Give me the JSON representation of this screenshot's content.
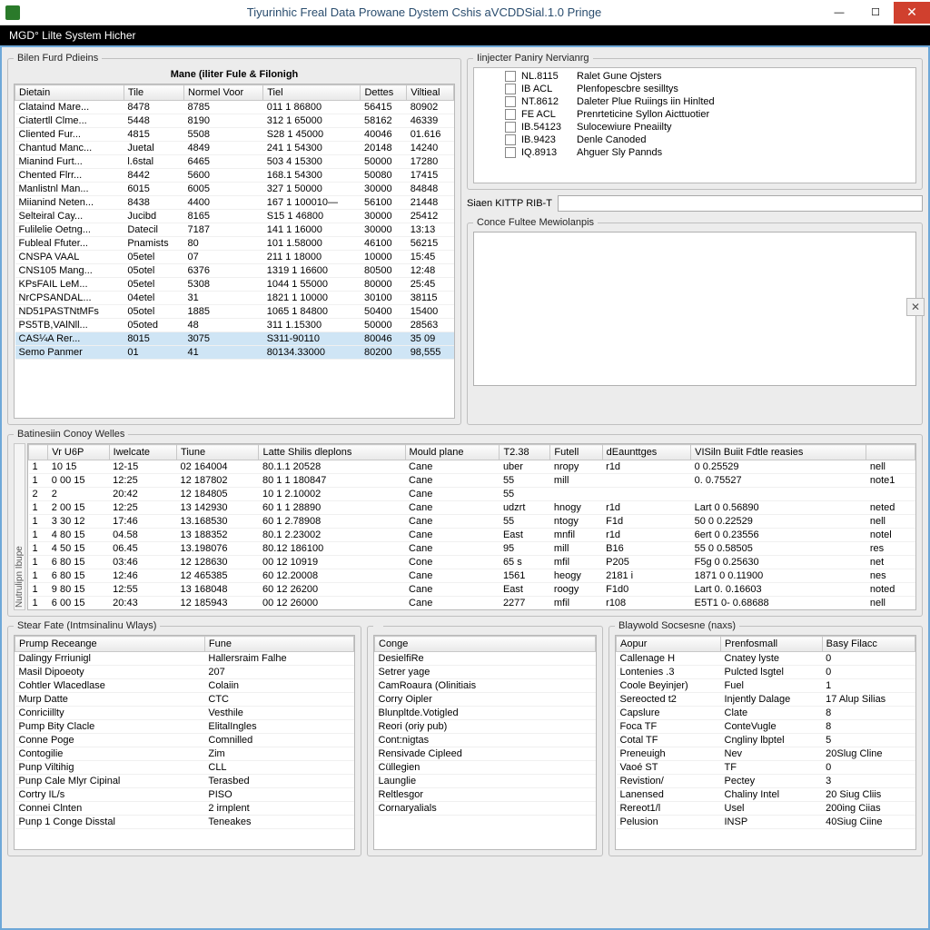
{
  "titlebar": {
    "title": "Tiyurinhic Freal Data Prowane Dystem Cshis aVCDDSial.1.0 Pringe"
  },
  "subheader": "MGD° Lilte System Hicher",
  "panel_filen": {
    "legend": "Bilen Furd Pdieins",
    "title": "Mane (iliter Fule & Filonigh",
    "columns": [
      "Dietain",
      "Tile",
      "Normel Voor",
      "Tiel",
      "Dettes",
      "Viltieal"
    ],
    "rows": [
      [
        "Clataind Mare...",
        "8478",
        "8785",
        "011 1 86800",
        "56415",
        "80902"
      ],
      [
        "Ciatertll Clme...",
        "5448",
        "8190",
        "312 1 65000",
        "58162",
        "46339"
      ],
      [
        "Cliented Fur...",
        "4815",
        "5508",
        "S28 1 45000",
        "40046",
        "01.616"
      ],
      [
        "Chantud Manc...",
        "Juetal",
        "4849",
        "241 1 54300",
        "20148",
        "14240"
      ],
      [
        "Mianind Furt...",
        "l.6stal",
        "6465",
        "503 4 15300",
        "50000",
        "17280"
      ],
      [
        "Chented Flrr...",
        "8442",
        "5600",
        "168.1 54300",
        "50080",
        "17415"
      ],
      [
        "Manlistnl Man...",
        "6015",
        "6005",
        "327 1 50000",
        "30000",
        "84848"
      ],
      [
        "Miianind Neten...",
        "8438",
        "4400",
        "167 1 100010—",
        "56100",
        "21448"
      ],
      [
        "Selteiral Cay...",
        "Jucibd",
        "8165",
        "S15  1 46800",
        "30000",
        "25412"
      ],
      [
        "Fulilelie Oetng...",
        "Datecil",
        "7187",
        "141 1 16000",
        "30000",
        "13:13"
      ],
      [
        "Fubleal Ffuter...",
        "Pnamists",
        "80",
        "101 1.58000",
        "46100",
        "56215"
      ]
    ],
    "rows2": [
      [
        "CNSPA VAAL",
        "05etel",
        "07",
        "211 1 18000",
        "10000",
        "15:45"
      ],
      [
        "CNS105 Mang...",
        "05otel",
        "6376",
        "1319 1 16600",
        "80500",
        "12:48"
      ],
      [
        "KPsFAIL LeM...",
        "05etel",
        "5308",
        "1044 1 55000",
        "80000",
        "25:45"
      ],
      [
        "NrCPSANDAL...",
        "04etel",
        "31",
        "1821 1 10000",
        "30100",
        "38115"
      ],
      [
        "ND51PASTNtMFs",
        "05otel",
        "1885",
        "1065 1 84800",
        "50400",
        "15400"
      ],
      [
        "PS5TB,VAlNll...",
        "05oted",
        "48",
        "311 1.15300",
        "50000",
        "28563"
      ]
    ],
    "rows_sel": [
      [
        "CAS¼A Rer...",
        "8015",
        "3075",
        "S311-90110",
        "80046",
        "35   09"
      ],
      [
        "Semo Panmer",
        "01",
        "41",
        "80134.33000",
        "80200",
        "98,555"
      ]
    ]
  },
  "panel_injecter": {
    "legend": "Iinjecter Paniry Nervianrg",
    "rows": [
      [
        "NL.8115",
        "Ralet Gune Ojsters"
      ],
      [
        "IB ACL",
        "Plenfopescbre sesilltys"
      ],
      [
        "NT.8612",
        "Daleter Plue Ruiings iin Hinlted"
      ],
      [
        "FE ACL",
        "Prenrteticine Syllon Aicttuotier"
      ],
      [
        "IB.54123",
        "Sulocewiure Pneaiilty"
      ],
      [
        "IB.9423",
        "Denle Canoded"
      ],
      [
        "IQ.8913",
        "Ahguer Sly Pannds"
      ]
    ]
  },
  "siaen": {
    "label": "Siaen  KITTP RIB-T",
    "value": ""
  },
  "panel_conce": {
    "legend": "Conce Fultee Mewiolanpis"
  },
  "panel_dat": {
    "legend": "Batinesiin Conoy Welles",
    "vlabel": "Nutrulipn Ibupe",
    "columns": [
      "",
      "Vr U6P",
      "Iwelcate",
      "Tiune",
      "Latte Shilis dleplons",
      "Mould plane",
      "T2.38",
      "Futell",
      "dEaunttges",
      "VISiln Buiit Fdtle reasies",
      ""
    ],
    "rows": [
      [
        "1",
        "10 15",
        "12-15",
        "02 164004",
        "80.1.1 20528",
        "Cane",
        "uber",
        "nropy",
        "r1d",
        "0   0.25529",
        "nell"
      ],
      [
        "1",
        "0   00 15",
        "12:25",
        "12 187802",
        "80 1 1 180847",
        "Cane",
        "55",
        "mill",
        "",
        "0.   0.75527",
        "note1"
      ],
      [
        "2",
        "2",
        "20:42",
        "12 184805",
        "10 1 2.10002",
        "Cane",
        "55",
        "",
        "",
        "",
        ""
      ],
      [
        "1",
        "2   00 15",
        "12:25",
        "13 142930",
        "60 1 1 28890",
        "Cane",
        "udzrt",
        "hnogy",
        "r1d",
        "Lart  0   0.56890",
        "neted"
      ],
      [
        "1",
        "3   30 12",
        "17:46",
        "13.168530",
        "60 1 2.78908",
        "Cane",
        "55",
        "ntogy",
        "F1d",
        "50   0  0.22529",
        "nell"
      ],
      [
        "1",
        "4   80 15",
        "04.58",
        "13 188352",
        "80.1 2.23002",
        "Cane",
        "East",
        "mnfil",
        "r1d",
        "6ert  0   0.23556",
        "notel"
      ],
      [
        "1",
        "4   50 15",
        "06.45",
        "13.198076",
        "80.12 186100",
        "Cane",
        "95",
        "mill",
        "B16",
        "55    0   0.58505",
        "res"
      ],
      [
        "1",
        "6   80 15",
        "03:46",
        "12 128630",
        "00 12 10919",
        "Cone",
        "65 s",
        "mfil",
        "P205",
        "F5g  0   0.25630",
        "net"
      ],
      [
        "1",
        "6   80 15",
        "12:46",
        "12 465385",
        "60 12.20008",
        "Cane",
        "1561",
        "heogy",
        "2181 i",
        "1871  0   0.11900",
        "nes"
      ],
      [
        "1",
        "9   80 15",
        "12:55",
        "13 168048",
        "60 12 26200",
        "Cane",
        "East",
        "roogy",
        "F1d0",
        "Lart  0.  0.16603",
        "noted"
      ],
      [
        "1",
        "6   00 15",
        "20:43",
        "12 185943",
        "00 12 26000",
        "Cane",
        "2277",
        "mfil",
        "r108",
        "E5T1  0- 0.68688",
        "nell"
      ]
    ]
  },
  "panel_stearA": {
    "legend": "Stear Fate (Intmsinalinu Wlays)",
    "columns": [
      "Prump Receange",
      "Fune"
    ],
    "rows": [
      [
        "Dalingy Frriunigl",
        "Hallersraim Falhe"
      ],
      [
        "Masil Dipoeoty",
        "207"
      ],
      [
        "Cohtler  Wlacedlase",
        "Colaiin"
      ],
      [
        "Murp Datte",
        "CTC"
      ],
      [
        "Conriciillty",
        "Vesthile"
      ],
      [
        "Pump Bity Clacle",
        "ElitalIngles"
      ],
      [
        "Conne Poge",
        "Comnilled"
      ],
      [
        "Contogilie",
        "Zim"
      ],
      [
        "Punp Viltihig",
        "CLL"
      ],
      [
        "Punp Cale Mlyr Cipinal",
        "Terasbed"
      ],
      [
        "Cortry IL/s",
        "PISO"
      ],
      [
        "Connei Clnten",
        "2 irnplent"
      ],
      [
        "Punp 1 Conge Disstal",
        "Teneakes"
      ]
    ]
  },
  "panel_stearB": {
    "columns": [
      "Conge"
    ],
    "rows": [
      [
        "DesielfiRe"
      ],
      [
        "Setrer yage"
      ],
      [
        "CamRoaura (Olinitiais"
      ],
      [
        "Corry Oipler"
      ],
      [
        "Blunpltde.Votigled"
      ],
      [
        "Reori (oriy pub)"
      ],
      [
        "Cont:nigtas"
      ],
      [
        "Rensivade Cipleed"
      ],
      [
        "Cüllegien"
      ],
      [
        "Launglie"
      ],
      [
        "Reltlesgor"
      ],
      [
        "Cornaryalials"
      ]
    ]
  },
  "panel_blay": {
    "legend": "Blaywold Socsesne (naxs)",
    "columns": [
      "Aopur",
      "Prenfosmall",
      "Basy Filacc"
    ],
    "rows": [
      [
        "Callenage H",
        "Cnatey lyste",
        "0"
      ],
      [
        "Lontenies .3",
        "Pulcted lsgtel",
        "0"
      ],
      [
        "Coole Beyinjer)",
        "Fuel",
        "1"
      ],
      [
        "Sereocted t2",
        "Injently Dalage",
        "17 Alup Silias"
      ],
      [
        "Capslure",
        "Clate",
        "8"
      ],
      [
        "Foca TF",
        "ConteVugle",
        "8"
      ],
      [
        "Cotal TF",
        "Cngliny lbptel",
        "5"
      ],
      [
        "Preneuigh",
        "Nev",
        "20Slug Cline"
      ],
      [
        "Vaoé ST",
        "TF",
        "0"
      ],
      [
        "Revistion/",
        "Pectey",
        "3"
      ],
      [
        "Lanensed",
        "Chaliny Intel",
        "20 Siug Cliis"
      ],
      [
        "Rereot1/l",
        "Usel",
        "200ing Ciias"
      ],
      [
        "Pelusion",
        "INSP",
        "40Siug Ciine"
      ]
    ]
  }
}
